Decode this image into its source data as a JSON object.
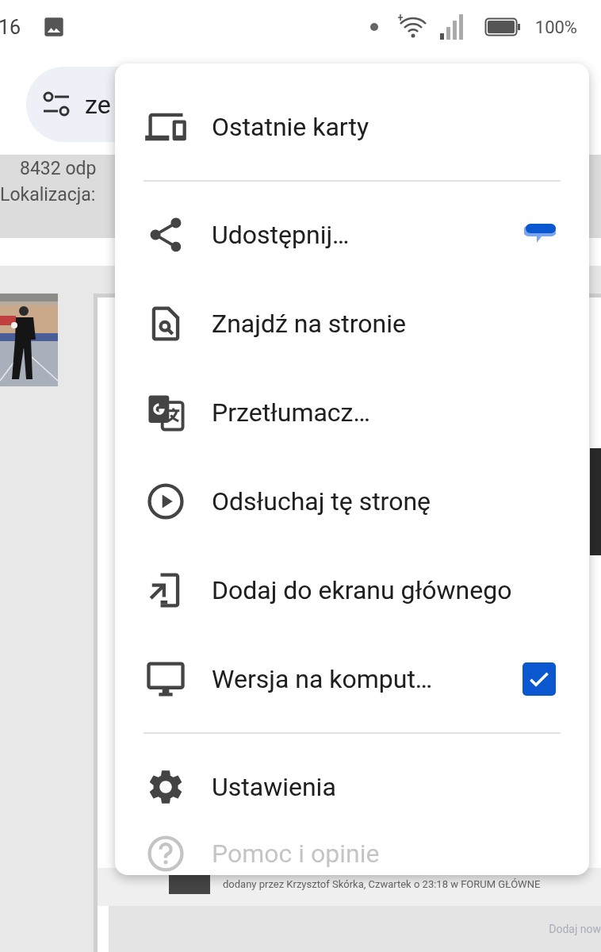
{
  "status_bar": {
    "time": "16",
    "battery": "100%"
  },
  "address_bar": {
    "text": "ze"
  },
  "page": {
    "header_lines": [
      "8432 odp",
      "Lokalizacja:"
    ],
    "post_meta": "dodany przez Krzysztof Skórka, Czwartek o 23:18 w FORUM GŁÓWNE",
    "footer_link": "Dodaj now"
  },
  "menu": {
    "sections": [
      [
        {
          "kind": "recent-tabs",
          "label": "Ostatnie karty",
          "disabled": false
        }
      ],
      [
        {
          "kind": "share",
          "label": "Udostępnij…",
          "disabled": false,
          "badge": true
        },
        {
          "kind": "find",
          "label": "Znajdź na stronie",
          "disabled": false
        },
        {
          "kind": "translate",
          "label": "Przetłumacz…",
          "disabled": false
        },
        {
          "kind": "listen",
          "label": "Odsłuchaj tę stronę",
          "disabled": false
        },
        {
          "kind": "add-home",
          "label": "Dodaj do ekranu głównego",
          "disabled": false
        },
        {
          "kind": "desktop",
          "label": "Wersja na komput…",
          "disabled": false,
          "checked": true
        }
      ],
      [
        {
          "kind": "settings",
          "label": "Ustawienia",
          "disabled": false
        },
        {
          "kind": "help",
          "label": "Pomoc i opinie",
          "disabled": true
        }
      ]
    ]
  }
}
